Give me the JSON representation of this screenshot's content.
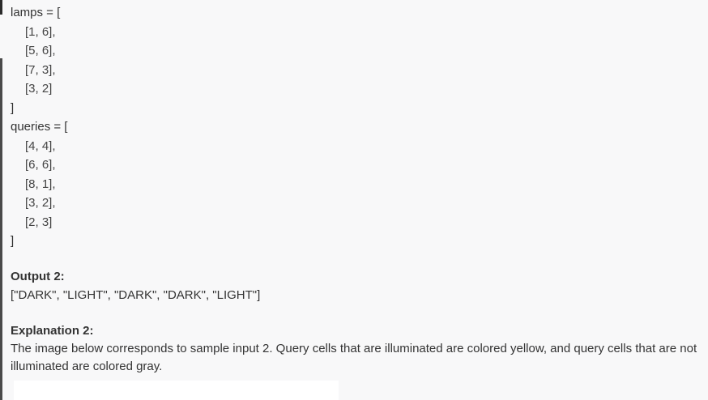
{
  "code": {
    "lamps_open": "lamps = [",
    "lamps": [
      "[1, 6],",
      "[5, 6],",
      "[7, 3],",
      "[3, 2]"
    ],
    "lamps_close": "]",
    "queries_open": "queries = [",
    "queries": [
      "[4, 4],",
      "[6, 6],",
      "[8, 1],",
      "[3, 2],",
      "[2, 3]"
    ],
    "queries_close": "]"
  },
  "output": {
    "heading": "Output 2:",
    "value": "[\"DARK\", \"LIGHT\", \"DARK\", \"DARK\", \"LIGHT\"]"
  },
  "explanation": {
    "heading": "Explanation 2:",
    "text": "The image below corresponds to sample input 2. Query cells that are illuminated are colored yellow, and query cells that are not illuminated are colored gray."
  }
}
